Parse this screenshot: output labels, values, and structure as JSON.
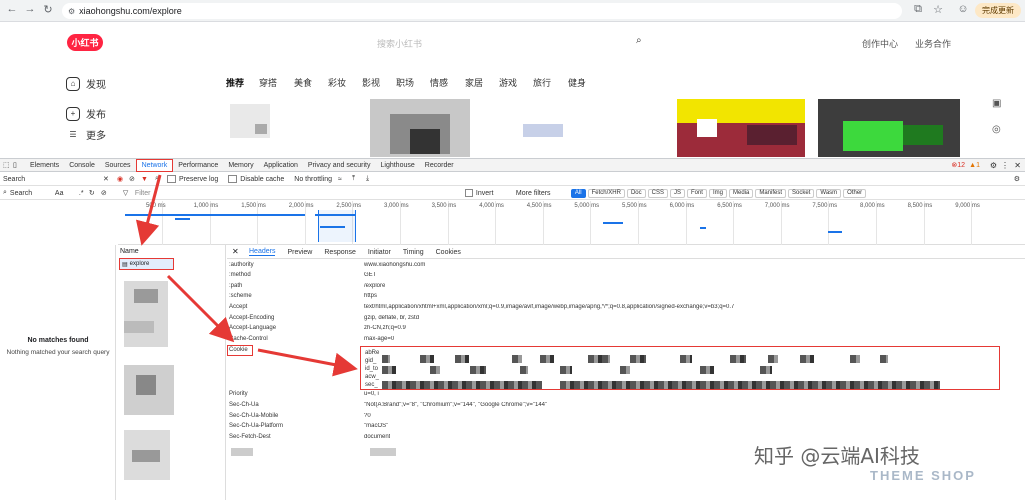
{
  "browser": {
    "url": "xiaohongshu.com/explore",
    "finish_update": "完成更新"
  },
  "site": {
    "logo": "小红书",
    "search_placeholder": "搜索小红书",
    "header_links": [
      "创作中心",
      "业务合作"
    ],
    "sidebar": [
      {
        "label": "发现",
        "icon": "home-icon"
      },
      {
        "label": "发布",
        "icon": "plus-icon"
      },
      {
        "label": "更多",
        "icon": "menu-icon"
      }
    ],
    "categories": [
      "推荐",
      "穿搭",
      "美食",
      "彩妆",
      "影视",
      "职场",
      "情感",
      "家居",
      "游戏",
      "旅行",
      "健身"
    ],
    "active_category": "推荐"
  },
  "devtools": {
    "tabs": [
      "Elements",
      "Console",
      "Sources",
      "Network",
      "Performance",
      "Memory",
      "Application",
      "Privacy and security",
      "Lighthouse",
      "Recorder"
    ],
    "selected_tab": "Network",
    "errors": "12",
    "warnings": "1",
    "search_label": "Search",
    "preserve_log": "Preserve log",
    "disable_cache": "Disable cache",
    "throttling": "No throttling",
    "filter_placeholder": "Filter",
    "invert": "Invert",
    "more_filters": "More filters",
    "type_filters": [
      "All",
      "Fetch/XHR",
      "Doc",
      "CSS",
      "JS",
      "Font",
      "Img",
      "Media",
      "Manifest",
      "Socket",
      "Wasm",
      "Other"
    ],
    "search_input_value": "Search",
    "search_options": [
      "Aa",
      ".*"
    ],
    "timeline_ticks": [
      "500 ms",
      "1,000 ms",
      "1,500 ms",
      "2,000 ms",
      "2,500 ms",
      "3,000 ms",
      "3,500 ms",
      "4,000 ms",
      "4,500 ms",
      "5,000 ms",
      "5,500 ms",
      "6,000 ms",
      "6,500 ms",
      "7,000 ms",
      "7,500 ms",
      "8,000 ms",
      "8,500 ms",
      "9,000 ms"
    ],
    "search_empty_title": "No matches found",
    "search_empty_desc": "Nothing matched your search query",
    "name_column": "Name",
    "selected_request": "explore",
    "detail_tabs": [
      "Headers",
      "Preview",
      "Response",
      "Initiator",
      "Timing",
      "Cookies"
    ],
    "selected_detail_tab": "Headers",
    "headers": [
      {
        "name": ":authority",
        "value": "www.xiaohongshu.com"
      },
      {
        "name": ":method",
        "value": "GET"
      },
      {
        "name": ":path",
        "value": "/explore"
      },
      {
        "name": ":scheme",
        "value": "https"
      },
      {
        "name": "Accept",
        "value": "text/html,application/xhtml+xml,application/xml;q=0.9,image/avif,image/webp,image/apng,*/*;q=0.8,application/signed-exchange;v=b3;q=0.7"
      },
      {
        "name": "Accept-Encoding",
        "value": "gzip, deflate, br, zstd"
      },
      {
        "name": "Accept-Language",
        "value": "zh-CN,zh;q=0.9"
      },
      {
        "name": "Cache-Control",
        "value": "max-age=0"
      },
      {
        "name": "Cookie",
        "value": ""
      },
      {
        "name": "Priority",
        "value": "u=0, i"
      },
      {
        "name": "Sec-Ch-Ua",
        "value": "\"Not(A:Brand\";v=\"8\", \"Chromium\";v=\"144\", \"Google Chrome\";v=\"144\""
      },
      {
        "name": "Sec-Ch-Ua-Mobile",
        "value": "?0"
      },
      {
        "name": "Sec-Ch-Ua-Platform",
        "value": "\"macOS\""
      },
      {
        "name": "Sec-Fetch-Dest",
        "value": "document"
      }
    ],
    "cookie_prefixes": [
      "abRe",
      "gid_",
      "id_to",
      "acw_",
      "sec_"
    ]
  },
  "watermark": {
    "text": "知乎 @云端AI科技",
    "brand": "THEME SHOP"
  },
  "colors": {
    "xhs_red": "#ff2442",
    "annotation_red": "#e53935",
    "devtools_blue": "#1a73e8"
  }
}
